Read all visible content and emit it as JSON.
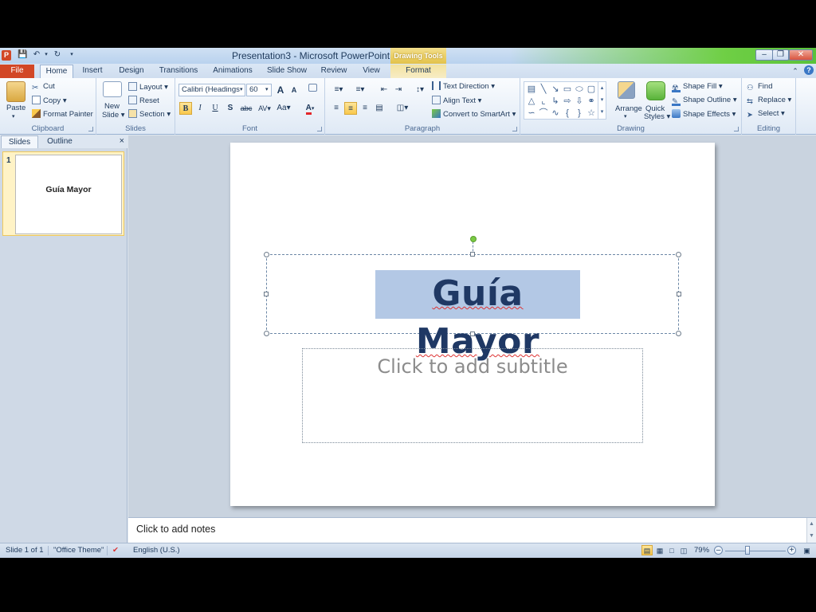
{
  "window": {
    "title": "Presentation3 - Microsoft PowerPoint",
    "contextual_tab_group": "Drawing Tools",
    "controls": [
      "minimize",
      "restore",
      "close"
    ]
  },
  "tabs": [
    {
      "label": "File"
    },
    {
      "label": "Home",
      "active": true
    },
    {
      "label": "Insert"
    },
    {
      "label": "Design"
    },
    {
      "label": "Transitions"
    },
    {
      "label": "Animations"
    },
    {
      "label": "Slide Show"
    },
    {
      "label": "Review"
    },
    {
      "label": "View"
    },
    {
      "label": "Format"
    }
  ],
  "ribbon": {
    "clipboard": {
      "label": "Clipboard",
      "paste": "Paste",
      "cut": "Cut",
      "copy": "Copy",
      "format_painter": "Format Painter"
    },
    "slides": {
      "label": "Slides",
      "new_slide": "New",
      "new_slide_2": "Slide",
      "layout": "Layout",
      "reset": "Reset",
      "section": "Section"
    },
    "font": {
      "label": "Font",
      "font_name": "Calibri (Headings)",
      "font_size": "60",
      "bold": "B",
      "italic": "I",
      "underline": "U",
      "strikethrough": "S",
      "shadow": "abc",
      "spacing": "AV",
      "change_case": "Aa",
      "font_color": "A",
      "grow": "A",
      "shrink": "A"
    },
    "paragraph": {
      "label": "Paragraph",
      "text_direction": "Text Direction",
      "align_text": "Align Text",
      "convert_smartart": "Convert to SmartArt"
    },
    "drawing": {
      "label": "Drawing",
      "arrange": "Arrange",
      "quick_styles": "Quick",
      "quick_styles_2": "Styles",
      "shape_fill": "Shape Fill",
      "shape_outline": "Shape Outline",
      "shape_effects": "Shape Effects"
    },
    "editing": {
      "label": "Editing",
      "find": "Find",
      "replace": "Replace",
      "select": "Select"
    }
  },
  "slides_pane": {
    "tabs": [
      "Slides",
      "Outline"
    ],
    "close": "×",
    "thumbnails": [
      {
        "number": "1",
        "title": "Guía Mayor"
      }
    ]
  },
  "slide": {
    "title": "Guía Mayor",
    "subtitle_placeholder": "Click to add subtitle"
  },
  "notes": {
    "placeholder": "Click to add notes"
  },
  "status": {
    "slide_info": "Slide 1 of 1",
    "theme": "\"Office Theme\"",
    "language": "English (U.S.)",
    "zoom": "79%",
    "zoom_level_percent": 79
  },
  "colors": {
    "file_tab": "#d24726",
    "title_highlight": "#b3c8e5",
    "title_text": "#1f3864",
    "rotation_handle": "#7ac943"
  }
}
